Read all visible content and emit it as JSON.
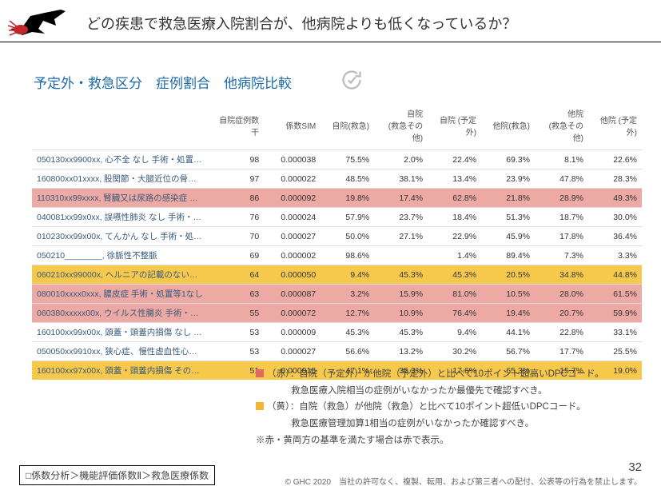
{
  "title": "どの疾患で救急医療入院割合が、他病院よりも低くなっているか？",
  "subtitle": "予定外・救急区分　症例割合　他病院比較",
  "columns": [
    "",
    "自院症例数 干",
    "係数SIM",
    "自院(救急)",
    "自院\n(救急その他)",
    "自院 (予定外)",
    "他院(救急)",
    "他院\n(救急その他)",
    "他院 (予定外)"
  ],
  "rows": [
    {
      "cls": "",
      "c": [
        "050130xx9900xx, 心不全 なし 手術・処置等1なし..",
        "98",
        "0.000038",
        "75.5%",
        "2.0%",
        "22.4%",
        "69.3%",
        "8.1%",
        "22.6%"
      ]
    },
    {
      "cls": "",
      "c": [
        "160800xx01xxxx, 股関節・大腿近位の骨折 人工骨..",
        "97",
        "0.000022",
        "48.5%",
        "38.1%",
        "13.4%",
        "23.9%",
        "47.8%",
        "28.3%"
      ]
    },
    {
      "cls": "row-red",
      "c": [
        "110310xx99xxxx, 腎臓又は尿路の感染症 なし",
        "86",
        "0.000092",
        "19.8%",
        "17.4%",
        "62.8%",
        "21.8%",
        "28.9%",
        "49.3%"
      ]
    },
    {
      "cls": "",
      "c": [
        "040081xx99x0xx, 誤嚥性肺炎 なし 手術・処置等2..",
        "76",
        "0.000024",
        "57.9%",
        "23.7%",
        "18.4%",
        "51.3%",
        "18.7%",
        "30.0%"
      ]
    },
    {
      "cls": "",
      "c": [
        "010230xx99x00x, てんかん なし 手術・処置等2な..",
        "70",
        "0.000027",
        "50.0%",
        "27.1%",
        "22.9%",
        "45.9%",
        "17.8%",
        "36.4%"
      ]
    },
    {
      "cls": "",
      "c": [
        "050210________, 徐脈性不整脈",
        "69",
        "0.000002",
        "98.6%",
        "",
        "1.4%",
        "89.4%",
        "7.3%",
        "3.3%"
      ]
    },
    {
      "cls": "row-yel",
      "c": [
        "060210xx99000x, ヘルニアの記載のない腸閉塞..",
        "64",
        "0.000050",
        "9.4%",
        "45.3%",
        "45.3%",
        "20.5%",
        "34.8%",
        "44.8%"
      ]
    },
    {
      "cls": "row-red",
      "c": [
        "080010xxxx0xxx, 膿皮症 手術・処置等1なし",
        "63",
        "0.000087",
        "3.2%",
        "15.9%",
        "81.0%",
        "10.5%",
        "28.0%",
        "61.5%"
      ]
    },
    {
      "cls": "row-red",
      "c": [
        "060380xxxxx00x, ウイルス性腸炎 手術・処置等2..",
        "55",
        "0.000072",
        "12.7%",
        "10.9%",
        "76.4%",
        "19.4%",
        "20.7%",
        "59.9%"
      ]
    },
    {
      "cls": "",
      "c": [
        "160100xx99x00x, 頭蓋・頭蓋内損傷 なし 手術・..",
        "53",
        "0.000009",
        "45.3%",
        "45.3%",
        "9.4%",
        "44.1%",
        "22.8%",
        "33.1%"
      ]
    },
    {
      "cls": "",
      "c": [
        "050050xx9910xx, 狭心症、慢性虚血性心疾患 なし..",
        "53",
        "0.000027",
        "56.6%",
        "13.2%",
        "30.2%",
        "56.7%",
        "17.7%",
        "25.5%"
      ]
    },
    {
      "cls": "row-yel",
      "c": [
        "160100xx97x00x, 頭蓋・頭蓋内損傷 その他の手術..",
        "51",
        "0.000015",
        "47.1%",
        "35.3%",
        "17.6%",
        "65.3%",
        "15.7%",
        "19.0%"
      ]
    }
  ],
  "legend": {
    "red1": "（赤）：自院（予定外）が他院（予定外）と比べて10ポイント超高いDPCコード。",
    "red2": "救急医療入院相当の症例がいなかったか最優先で確認すべき。",
    "yel1": "（黄）：自院（救急）が他院（救急）と比べて10ポイント超低いDPCコード。",
    "yel2": "救急医療管理加算1相当の症例がいなかったか確認すべき。",
    "note": "※赤・黄両方の基準を満たす場合は赤で表示。"
  },
  "footer_nav": "□係数分析＞機能評価係数Ⅱ＞救急医療係数",
  "page": "32",
  "copyright": "© GHC 2020　当社の許可なく、複製、転用、および第三者への配付、公表等の行為を禁止します。"
}
